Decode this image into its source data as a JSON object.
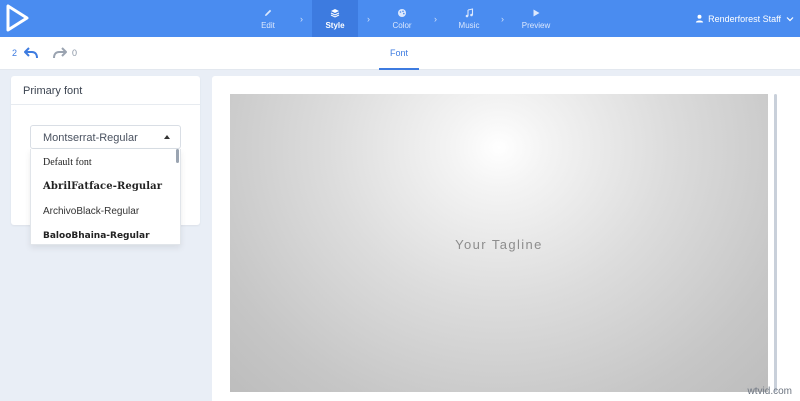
{
  "nav": {
    "steps": [
      {
        "label": "Edit",
        "icon": "pencil-icon"
      },
      {
        "label": "Style",
        "icon": "layers-icon",
        "active": true
      },
      {
        "label": "Color",
        "icon": "palette-icon"
      },
      {
        "label": "Music",
        "icon": "music-note-icon"
      },
      {
        "label": "Preview",
        "icon": "play-icon"
      }
    ],
    "user_name": "Renderforest Staff"
  },
  "toolbar": {
    "undo_count": "2",
    "redo_count": "0",
    "tab_label": "Font"
  },
  "font_panel": {
    "title": "Primary font",
    "selected": "Montserrat-Regular",
    "options": [
      "Default font",
      "AbrilFatface-Regular",
      "ArchivoBlack-Regular",
      "BalooBhaina-Regular"
    ]
  },
  "preview": {
    "tagline": "Your Tagline"
  },
  "watermark": "wtvid.com",
  "colors": {
    "accent": "#4a8cf0",
    "active_step": "#3d7be0"
  }
}
